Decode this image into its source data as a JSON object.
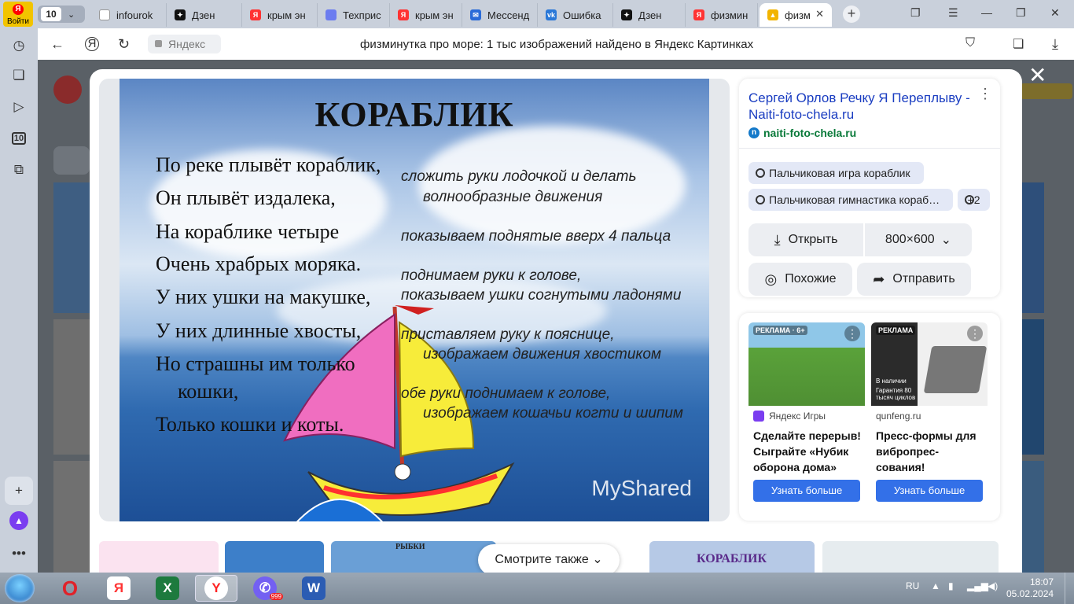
{
  "browser": {
    "voity_label": "Войти",
    "tab_count": "10",
    "tabs": [
      {
        "label": "infourok",
        "fav": "#fff"
      },
      {
        "label": "Дзен",
        "fav": "#111"
      },
      {
        "label": "крым эн",
        "fav": "#f33"
      },
      {
        "label": "Техприс",
        "fav": "#6b7cf0"
      },
      {
        "label": "крым эн",
        "fav": "#f33"
      },
      {
        "label": "Мессенд",
        "fav": "#2a6bd8"
      },
      {
        "label": "Ошибка",
        "fav": "#2a78d8"
      },
      {
        "label": "Дзен",
        "fav": "#111"
      },
      {
        "label": "физмин",
        "fav": "#f33"
      },
      {
        "label": "физм",
        "fav": "#f2b400"
      }
    ],
    "address_domain": "Яндекс",
    "page_title": "физминутка про море: 1 тыс изображений найдено в Яндекс Картинках",
    "sidebar_count": "10"
  },
  "image": {
    "title": "КОРАБЛИК",
    "poem": [
      "По реке плывёт кораблик,",
      "Он плывёт издалека,",
      "На кораблике четыре",
      "Очень храбрых моряка.",
      "У них ушки на макушке,",
      "У них длинные хвосты,",
      "Но страшны им только",
      "кошки,",
      "Только кошки и коты."
    ],
    "notes": [
      "сложить руки лодочкой и делать",
      "волнообразные движения",
      "показываем поднятые вверх 4 пальца",
      "поднимаем руки к голове,",
      "показываем ушки согнутыми ладонями",
      "приставляем руку к пояснице,",
      "изображаем движения хвостиком",
      "обе руки поднимаем к голове,",
      "изображаем кошачьи когти и шипим"
    ],
    "watermark": "MyShared"
  },
  "info": {
    "title": "Сергей Орлов Речку Я Переплыву - Naiti-foto-chela.ru",
    "site": "naiti-foto-chela.ru",
    "site_letter": "n",
    "chips": [
      "Пальчиковая игра кораблик",
      "Пальчиковая гимнастика кораб…"
    ],
    "more_chips": "+2",
    "open_label": "Открыть",
    "size_label": "800×600",
    "similar_label": "Похожие",
    "share_label": "Отправить"
  },
  "ads": [
    {
      "tag": "РЕКЛАМА · 6+",
      "source": "Яндекс Игры",
      "title": "Сделайте перерыв! Сыграйте «Нубик оборона дома»",
      "button": "Узнать больше"
    },
    {
      "tag": "РЕКЛАМА",
      "source": "qunfeng.ru",
      "title": "Пресс-формы для вибропрес-сования!",
      "button": "Узнать больше",
      "banner_lines": [
        "В наличии",
        "Гарантия 80 тысяч циклов"
      ]
    }
  ],
  "bottom": {
    "see_also": "Смотрите также",
    "thumb_titles": [
      "РЫБКИ",
      "КОРАБЛИК"
    ]
  },
  "taskbar": {
    "lang": "RU",
    "time": "18:07",
    "date": "05.02.2024",
    "viber_badge": "999"
  }
}
